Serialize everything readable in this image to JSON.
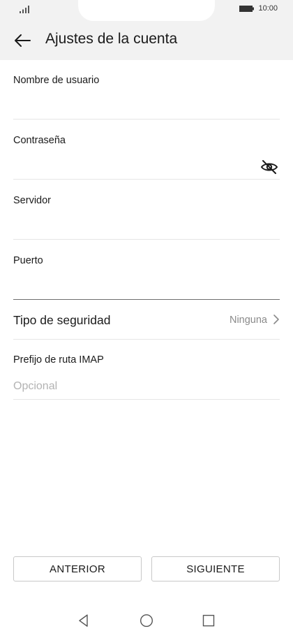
{
  "status_bar": {
    "time": "10:00",
    "signal_icon": "signal-icon",
    "battery_icon": "battery-icon"
  },
  "header": {
    "title": "Ajustes de la cuenta",
    "back_icon": "arrow-left-icon"
  },
  "form": {
    "username": {
      "label": "Nombre de usuario",
      "value": "",
      "placeholder": ""
    },
    "password": {
      "label": "Contraseña",
      "value": "",
      "placeholder": "",
      "toggle_icon": "eye-off-icon"
    },
    "server": {
      "label": "Servidor",
      "value": "",
      "placeholder": ""
    },
    "port": {
      "label": "Puerto",
      "value": "",
      "placeholder": ""
    },
    "security": {
      "label": "Tipo de seguridad",
      "value": "Ninguna",
      "chevron_icon": "chevron-right-icon"
    },
    "imap_prefix": {
      "label": "Prefijo de ruta IMAP",
      "value": "",
      "placeholder": "Opcional"
    }
  },
  "buttons": {
    "previous": "ANTERIOR",
    "next": "SIGUIENTE"
  },
  "navbar": {
    "back": "nav-back-icon",
    "home": "nav-home-icon",
    "recents": "nav-recents-icon"
  }
}
